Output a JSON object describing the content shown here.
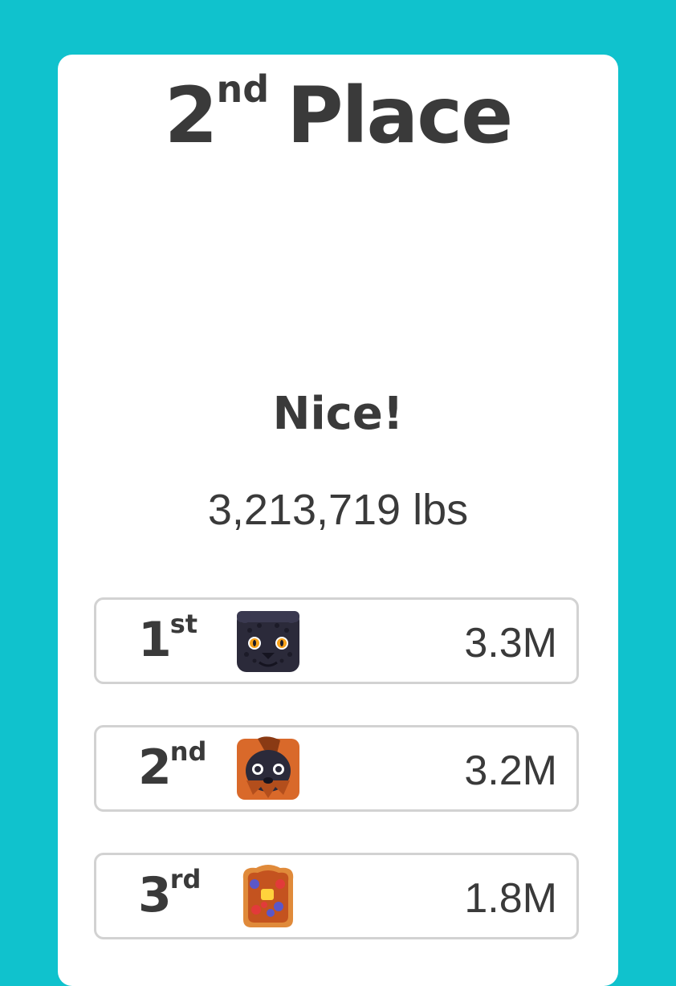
{
  "header": {
    "place_number": "2",
    "place_suffix": "nd",
    "place_word": "Place"
  },
  "result": {
    "message": "Nice!",
    "score": "3,213,719 lbs"
  },
  "leaderboard": {
    "rows": [
      {
        "rank": "1",
        "suffix": "st",
        "avatar": "black-panther-avatar",
        "value": "3.3M"
      },
      {
        "rank": "2",
        "suffix": "nd",
        "avatar": "brown-maned-creature-avatar",
        "value": "3.2M"
      },
      {
        "rank": "3",
        "suffix": "rd",
        "avatar": "berry-toast-avatar",
        "value": "1.8M"
      }
    ]
  },
  "colors": {
    "background": "#10c2cd",
    "card": "#ffffff",
    "text": "#3a3a3a",
    "row_border": "#d2d2d2"
  }
}
